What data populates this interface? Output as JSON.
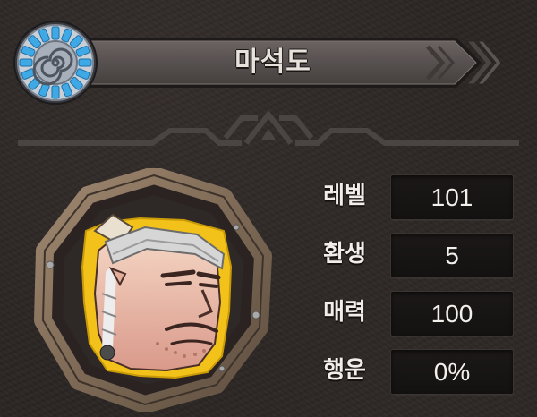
{
  "character": {
    "name": "마석도"
  },
  "stats": [
    {
      "label": "레벨",
      "value": "101"
    },
    {
      "label": "환생",
      "value": "5"
    },
    {
      "label": "매력",
      "value": "100"
    },
    {
      "label": "행운",
      "value": "0%"
    }
  ],
  "icons": {
    "emblem": "spiral-emblem-icon",
    "banner_end": "double-chevron-right-icon"
  },
  "colors": {
    "background": "#2b2624",
    "banner": "#5a5350",
    "emblem_blue": "#3fa9e6",
    "frame_wood": "#8a7560",
    "portrait_border": "#f2c21a"
  }
}
